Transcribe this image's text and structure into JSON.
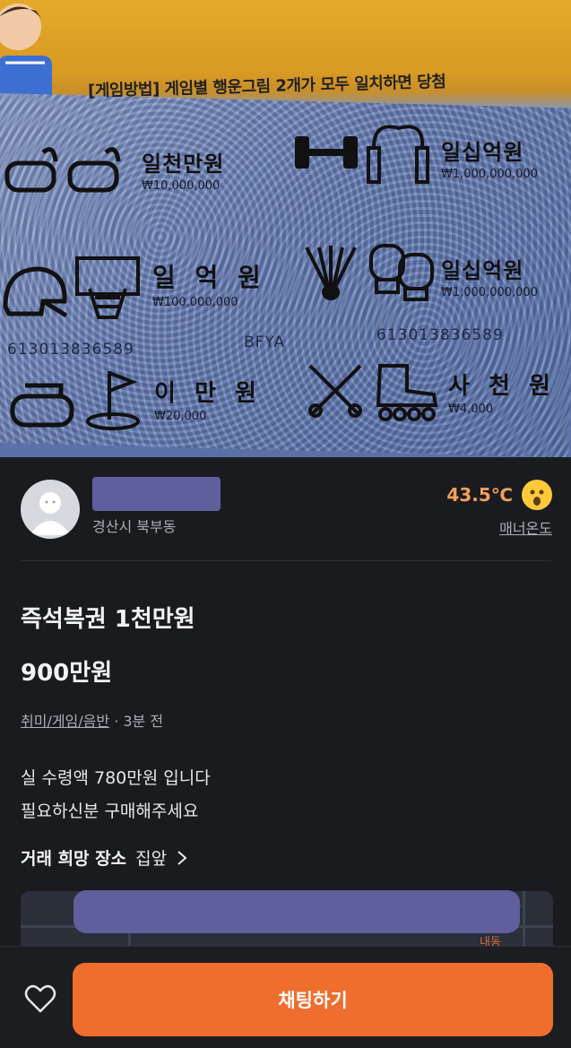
{
  "photo": {
    "howto_text": "[게임방법] 게임별 행운그림 2개가 모두 일치하면 당첨",
    "prizes": [
      {
        "label": "일천만원",
        "amount": "₩10,000,000"
      },
      {
        "label": "일십억원",
        "amount": "₩1,000,000,000"
      },
      {
        "label": "일 억 원",
        "amount": "₩100,000,000"
      },
      {
        "label": "일십억원",
        "amount": "₩1,000,000,000"
      },
      {
        "label": "이 만 원",
        "amount": "₩20,000"
      },
      {
        "label": "사 천 원",
        "amount": "₩4,000"
      }
    ],
    "serials": [
      "613013836589",
      "613013836589"
    ],
    "code": "BFYA"
  },
  "seller": {
    "location": "경산시 북부동",
    "temperature": "43.5℃",
    "manner_label": "매너온도",
    "avatar_icon": "user-avatar-icon",
    "emoji_icon": "surprised-face-icon"
  },
  "article": {
    "title": "즉석복권 1천만원",
    "price": "900만원",
    "category": "취미/게임/음반",
    "time": " · 3분 전",
    "desc_line1": "실 수령액 780만원 입니다",
    "desc_line2": "필요하신분 구매해주세요",
    "place_label": "거래 희망 장소",
    "place_value": "집앞",
    "chevron_icon": "chevron-right-icon"
  },
  "map": {
    "label": "내동"
  },
  "bottom": {
    "heart_icon": "heart-outline-icon",
    "chat_button": "채팅하기"
  },
  "colors": {
    "background": "#1a1b1f",
    "accent": "#ef6e2e",
    "temperature": "#f4a05c",
    "redaction": "#5f5f9e"
  }
}
